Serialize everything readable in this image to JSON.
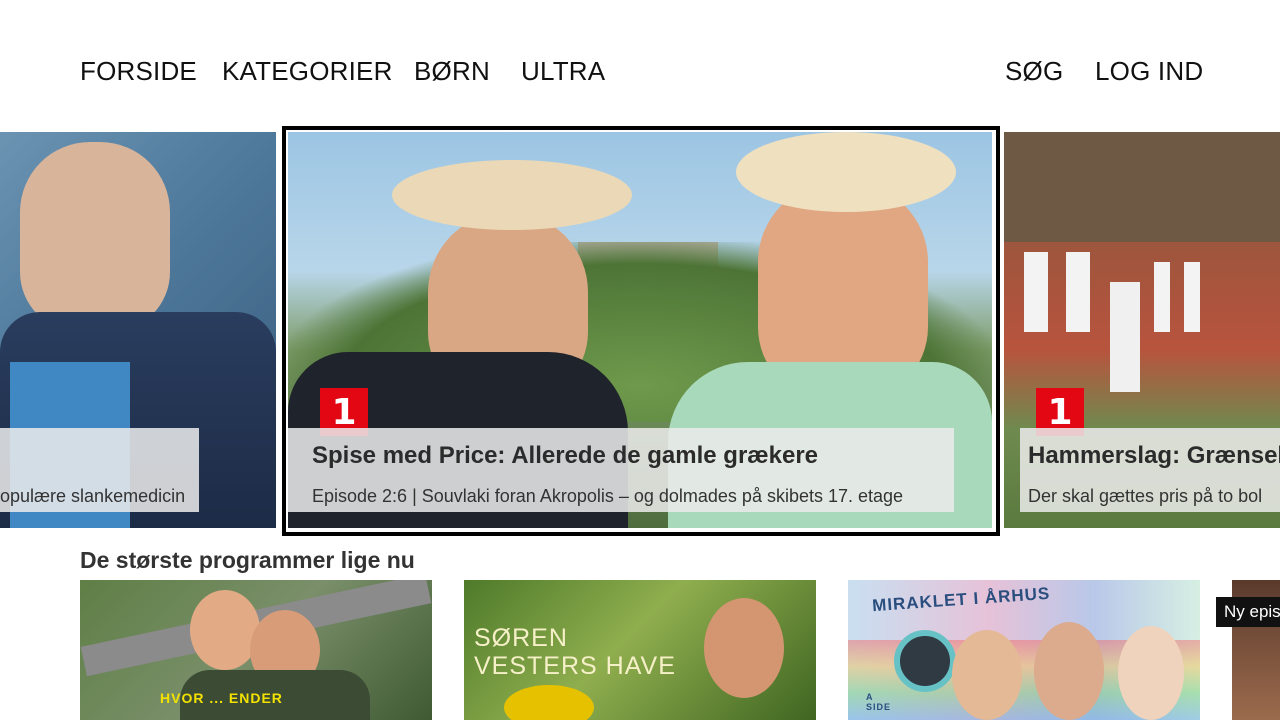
{
  "nav": {
    "left": [
      "FORSIDE",
      "KATEGORIER",
      "BØRN",
      "ULTRA"
    ],
    "search": "SØG",
    "login": "LOG IND"
  },
  "hero": [
    {
      "title": "",
      "subtitle": "opulære slankemedicin",
      "channel_logo": ""
    },
    {
      "title": "Spise med Price: Allerede de gamle grækere",
      "subtitle": "Episode 2:6 | Souvlaki foran Akropolis – og dolmades på skibets 17. etage",
      "channel_logo": "1"
    },
    {
      "title": "Hammerslag: Grænsel",
      "subtitle": "Der skal gættes pris på to bol",
      "channel_logo": "1"
    }
  ],
  "section": {
    "title": "De største programmer lige nu",
    "thumbnails": [
      {
        "text": "HVOR ... ENDER"
      },
      {
        "text": "SØREN VESTERS HAVE"
      },
      {
        "text": "MIRAKLET I ÅRHUS",
        "side_label": "A SIDE"
      },
      {
        "badge": "Ny epis"
      }
    ]
  }
}
